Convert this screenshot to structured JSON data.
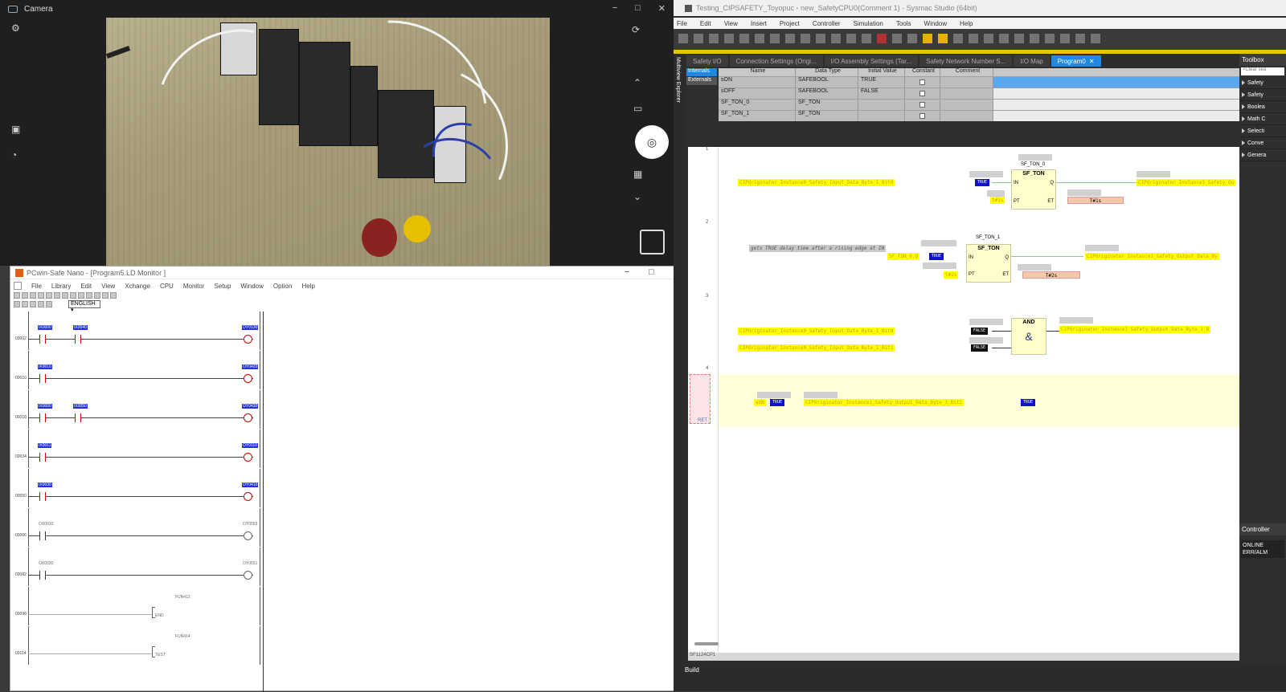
{
  "camera": {
    "title": "Camera",
    "controls": [
      "−",
      "□",
      "✕"
    ]
  },
  "pcwin": {
    "title": "PCwin-Safe Nano - [Program5.LD  Monitor ]",
    "menu": [
      "File",
      "Library",
      "Edit",
      "View",
      "Xchange",
      "CPU",
      "Monitor",
      "Setup",
      "Window",
      "Option",
      "Help"
    ],
    "language": "ENGLISH",
    "rungs": [
      {
        "step": "00002",
        "contacts": [
          "IX0000",
          "IX0040"
        ],
        "coil": "OY0130",
        "active": true
      },
      {
        "step": "00010",
        "contacts": [
          "IX0010"
        ],
        "coil": "OY0420",
        "active": true
      },
      {
        "step": "00018",
        "contacts": [
          "IX0000",
          "IX0050"
        ],
        "coil": "OY0430",
        "active": true
      },
      {
        "step": "00034",
        "contacts": [
          "IX0011"
        ],
        "coil": "OY0110",
        "active": true
      },
      {
        "step": "00050",
        "contacts": [
          "IX0030"
        ],
        "coil": "OY0410",
        "active": true
      },
      {
        "step": "00066",
        "contacts": [
          "OX0010"
        ],
        "coil": "OY0555",
        "active": false
      },
      {
        "step": "00082",
        "contacts": [
          "OX0030"
        ],
        "coil": "OY0551",
        "active": false
      },
      {
        "step": "00098",
        "contacts": [],
        "coil": "FUN412",
        "func": "END",
        "active": false
      },
      {
        "step": "00114",
        "contacts": [],
        "coil": "FUN414",
        "func": "TEST",
        "active": false
      }
    ]
  },
  "sysmac": {
    "title": "Testing_CIPSAFETY_Toyopuc - new_SafetyCPU0(Comment 1) - Sysmac Studio (64bit)",
    "menu": [
      "File",
      "Edit",
      "View",
      "Insert",
      "Project",
      "Controller",
      "Simulation",
      "Tools",
      "Window",
      "Help"
    ],
    "multiview": "Multiview Explorer",
    "tabs": [
      "Safety I/O",
      "Connection Settings (Origi...",
      "I/O Assembly Settings (Tar...",
      "Safety Network Number S...",
      "I/O Map",
      "Program0"
    ],
    "var_tabs": [
      "Internals",
      "Externals"
    ],
    "var_headers": [
      "Name",
      "Data Type",
      "Initial Value",
      "Constant",
      "Comment"
    ],
    "variables": [
      {
        "name": "sON",
        "type": "SAFEBOOL",
        "init": "TRUE"
      },
      {
        "name": "sOFF",
        "type": "SAFEBOOL",
        "init": "FALSE"
      },
      {
        "name": "SF_TON_0",
        "type": "SF_TON",
        "init": ""
      },
      {
        "name": "SF_TON_1",
        "type": "SF_TON",
        "init": ""
      }
    ],
    "ladder": {
      "r1": {
        "no": "1",
        "in_var": "CIPOriginator_Instance0_Safety_Input_Data_Byte_1_Bit0",
        "in_val": "TRUE",
        "inst": "SF_TON_0",
        "fb": "SF_TON",
        "pin_in": "IN",
        "pin_q": "Q",
        "pin_pt": "PT",
        "pin_et": "ET",
        "pt": "t#1s",
        "et": "T#1s",
        "out_var": "CIPOriginator_Instance1_Safety_Ou"
      },
      "r2": {
        "no": "2",
        "comment": "gets TRUE delay time after a rising edge at IN",
        "in_var": "SF_TON_0.Q",
        "in_val": "TRUE",
        "inst": "SF_TON_1",
        "fb": "SF_TON",
        "pin_in": "IN",
        "pin_q": "Q",
        "pin_pt": "PT",
        "pin_et": "ET",
        "pt": "t#2s",
        "et": "T#2s",
        "out_var": "CIPOriginator_Instance1_Safety_Output_Data_By"
      },
      "r3": {
        "no": "3",
        "in1": "CIPOriginator_Instance0_Safety_Input_Data_Byte_1_Bit0",
        "v1": "FALSE",
        "in2": "CIPOriginator_Instance0_Safety_Input_Data_Byte_1_Bit1",
        "v2": "FALSE",
        "fb": "AND",
        "sym": "&",
        "out_var": "CIPOriginator_Instance1_Safety_Output_Data_Byte_1_B"
      },
      "r4": {
        "no": "4",
        "in_var": "sON",
        "in_val": "TRUE",
        "out_var": "CIPOriginator_Instance1_Safety_Output_Data_Byte_1_Bit1",
        "out_val": "TRUE"
      },
      "ret": "RET"
    },
    "toolbox": {
      "title": "Toolbox",
      "search": "<Clear sea",
      "items": [
        "Safety",
        "Safety",
        "Boolea",
        "Math C",
        "Selecti",
        "Conve",
        "Genera"
      ]
    },
    "controller": {
      "title": "Controller",
      "status": "ONLINE\nERR/ALM"
    },
    "status_bar": "SF1124CP1",
    "build": "Build"
  }
}
